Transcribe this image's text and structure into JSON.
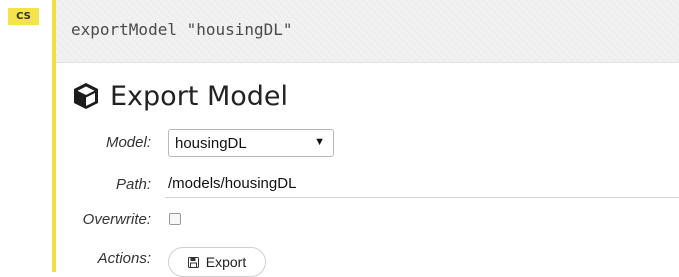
{
  "cell": {
    "type_badge": "CS",
    "code": "exportModel \"housingDL\""
  },
  "form": {
    "title": "Export Model",
    "title_icon": "cube-icon",
    "model": {
      "label": "Model:",
      "selected": "housingDL"
    },
    "path": {
      "label": "Path:",
      "value": "/models/housingDL"
    },
    "overwrite": {
      "label": "Overwrite:",
      "checked": false
    },
    "actions": {
      "label": "Actions:",
      "export_label": "Export",
      "export_icon": "floppy-disk-icon"
    }
  },
  "colors": {
    "badge": "#f4e34a",
    "rail": "#f3dd45",
    "code_bg": "#f1f1f1"
  }
}
